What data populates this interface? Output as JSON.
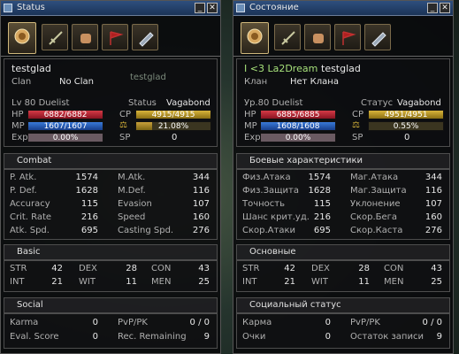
{
  "left": {
    "title": "Status",
    "player_name": "testglad",
    "name_ghost": "testglad",
    "clan_label": "Clan",
    "clan_value": "No Clan",
    "level_class": "Lv  80 Duelist",
    "status_label": "Status",
    "status_value": "Vagabond",
    "bars": {
      "hp_label": "HP",
      "hp_text": "6882/6882",
      "hp_fill": 1.0,
      "mp_label": "MP",
      "mp_text": "1607/1607",
      "mp_fill": 1.0,
      "exp_label": "Exp",
      "exp_text": "0.00%",
      "exp_fill": 0.0,
      "cp_label": "CP",
      "cp_text": "4915/4915",
      "cp_fill": 1.0,
      "weight_text": "21.08%",
      "weight_fill": 0.2108,
      "sp_label": "SP",
      "sp_value": "0"
    },
    "combat_title": "Combat",
    "combat": [
      [
        "P. Atk.",
        "1574",
        "M.Atk.",
        "344"
      ],
      [
        "P. Def.",
        "1628",
        "M.Def.",
        "116"
      ],
      [
        "Accuracy",
        "115",
        "Evasion",
        "107"
      ],
      [
        "Crit. Rate",
        "216",
        "Speed",
        "160"
      ],
      [
        "Atk. Spd.",
        "695",
        "Casting Spd.",
        "276"
      ]
    ],
    "basic_title": "Basic",
    "basic": [
      [
        "STR",
        "42",
        "DEX",
        "28",
        "CON",
        "43"
      ],
      [
        "INT",
        "21",
        "WIT",
        "11",
        "MEN",
        "25"
      ]
    ],
    "social_title": "Social",
    "social": [
      [
        "Karma",
        "0",
        "PvP/PK",
        "0 / 0"
      ],
      [
        "Eval. Score",
        "0",
        "Rec. Remaining",
        "9"
      ]
    ]
  },
  "right": {
    "title": "Состояние",
    "title_prefix": "I <3 La2Dream",
    "player_name": "testglad",
    "clan_label": "Клан",
    "clan_value": "Нет Клана",
    "level_class": "Ур.80 Duelist",
    "status_label": "Статус",
    "status_value": "Vagabond",
    "bars": {
      "hp_label": "HP",
      "hp_text": "6885/6885",
      "hp_fill": 1.0,
      "mp_label": "MP",
      "mp_text": "1608/1608",
      "mp_fill": 1.0,
      "exp_label": "Exp",
      "exp_text": "0.00%",
      "exp_fill": 0.0,
      "cp_label": "CP",
      "cp_text": "4951/4951",
      "cp_fill": 1.0,
      "weight_text": "0.55%",
      "weight_fill": 0.0055,
      "sp_label": "SP",
      "sp_value": "0"
    },
    "combat_title": "Боевые характеристики",
    "combat": [
      [
        "Физ.Атака",
        "1574",
        "Маг.Атака",
        "344"
      ],
      [
        "Физ.Защита",
        "1628",
        "Маг.Защита",
        "116"
      ],
      [
        "Точность",
        "115",
        "Уклонение",
        "107"
      ],
      [
        "Шанс крит.уд.",
        "216",
        "Скор.Бега",
        "160"
      ],
      [
        "Скор.Атаки",
        "695",
        "Скор.Каста",
        "276"
      ]
    ],
    "basic_title": "Основные",
    "basic": [
      [
        "STR",
        "42",
        "DEX",
        "28",
        "CON",
        "43"
      ],
      [
        "INT",
        "21",
        "WIT",
        "11",
        "MEN",
        "25"
      ]
    ],
    "social_title": "Социальный статус",
    "social": [
      [
        "Карма",
        "0",
        "PvP/PK",
        "0 / 0"
      ],
      [
        "Очки",
        "0",
        "Остаток записи",
        "9"
      ]
    ]
  },
  "colors": {
    "hp": "#c8303c",
    "mp": "#2f66c4",
    "cp": "#c9a22e",
    "titlebar": "#24426b"
  },
  "icons": [
    "status-tab-icon",
    "skills-tab-icon",
    "actions-tab-icon",
    "clan-tab-icon",
    "quest-tab-icon"
  ]
}
